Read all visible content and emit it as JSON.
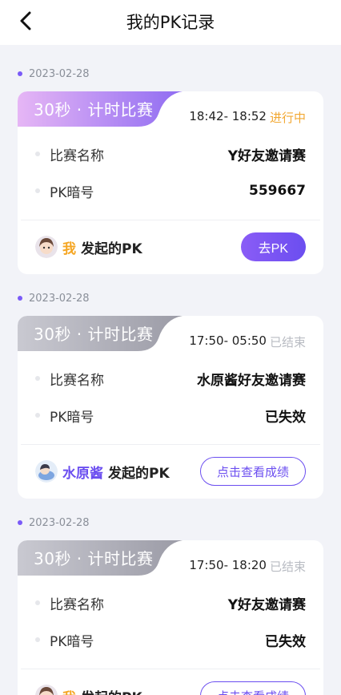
{
  "header": {
    "title": "我的PK记录"
  },
  "records": [
    {
      "date": "2023-02-28",
      "tag": "30秒 · 计时比赛",
      "time_range": "18:42- 18:52",
      "status": "进行中",
      "rows": [
        {
          "label": "比赛名称",
          "value": "Y好友邀请赛"
        },
        {
          "label": "PK暗号",
          "value": "559667"
        }
      ],
      "initiator_name": "我",
      "initiator_suffix": "发起的PK",
      "action": "去PK"
    },
    {
      "date": "2023-02-28",
      "tag": "30秒 · 计时比赛",
      "time_range": "17:50- 05:50",
      "status": "已结束",
      "rows": [
        {
          "label": "比赛名称",
          "value": "水原酱好友邀请赛"
        },
        {
          "label": "PK暗号",
          "value": "已失效"
        }
      ],
      "initiator_name": "水原酱",
      "initiator_suffix": "发起的PK",
      "action": "点击查看成绩"
    },
    {
      "date": "2023-02-28",
      "tag": "30秒 · 计时比赛",
      "time_range": "17:50- 18:20",
      "status": "已结束",
      "rows": [
        {
          "label": "比赛名称",
          "value": "Y好友邀请赛"
        },
        {
          "label": "PK暗号",
          "value": "已失效"
        }
      ],
      "initiator_name": "我",
      "initiator_suffix": "发起的PK",
      "action": "点击查看成绩"
    }
  ],
  "colors": {
    "accent": "#6b4ef0",
    "live": "#f2a833",
    "ended": "#b9bcc3"
  }
}
